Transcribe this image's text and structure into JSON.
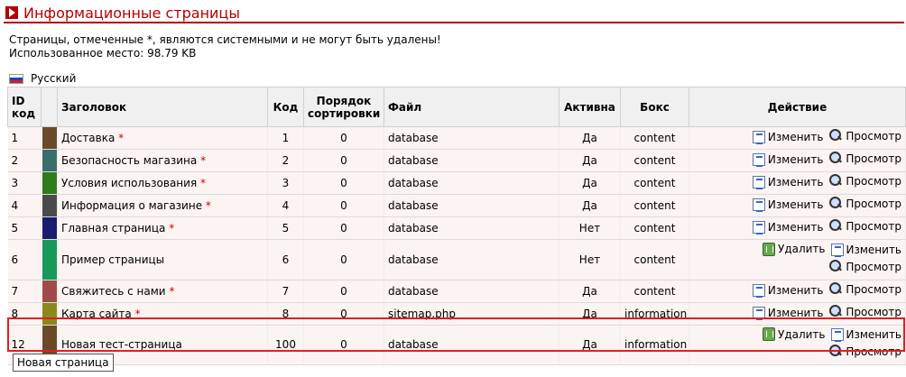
{
  "header": {
    "title": "Информационные страницы"
  },
  "notes": {
    "line1": "Страницы, отмеченные *, являются системными и не могут быть удалены!",
    "line2": "Использованное место: 98.79 KB"
  },
  "language": {
    "label": "Русский"
  },
  "columns": {
    "id": "ID",
    "id2": "код",
    "title": "Заголовок",
    "code": "Код",
    "sort": "Порядок",
    "sort2": "сортировки",
    "file": "Файл",
    "active": "Активна",
    "box": "Бокс",
    "action": "Действие"
  },
  "actions": {
    "edit": "Изменить",
    "view": "Просмотр",
    "delete": "Удалить"
  },
  "colors": {
    "accent": "#b40000",
    "row_bg": "#fcf3f3"
  },
  "rows": [
    {
      "id": "1",
      "title": "Доставка",
      "star": "*",
      "code": "1",
      "sort": "0",
      "file": "database",
      "active": "Да",
      "box": "content",
      "color": "#6b4a2a"
    },
    {
      "id": "2",
      "title": "Безопасность магазина",
      "star": "*",
      "code": "2",
      "sort": "0",
      "file": "database",
      "active": "Да",
      "box": "content",
      "color": "#3a6e6a"
    },
    {
      "id": "3",
      "title": "Условия использования",
      "star": "*",
      "code": "3",
      "sort": "0",
      "file": "database",
      "active": "Да",
      "box": "content",
      "color": "#2e7d1a"
    },
    {
      "id": "4",
      "title": "Информация о магазине",
      "star": "*",
      "code": "4",
      "sort": "0",
      "file": "database",
      "active": "Да",
      "box": "content",
      "color": "#4a4a4a"
    },
    {
      "id": "5",
      "title": "Главная страница",
      "star": "*",
      "code": "5",
      "sort": "0",
      "file": "database",
      "active": "Нет",
      "box": "content",
      "color": "#1a1a6e"
    },
    {
      "id": "6",
      "title": "Пример страницы",
      "star": "",
      "code": "6",
      "sort": "0",
      "file": "database",
      "active": "Нет",
      "box": "content",
      "color": "#1a9a5a"
    },
    {
      "id": "7",
      "title": "Свяжитесь с нами",
      "star": "*",
      "code": "7",
      "sort": "0",
      "file": "database",
      "active": "Да",
      "box": "content",
      "color": "#a04a4a"
    },
    {
      "id": "8",
      "title": "Карта сайта",
      "star": "*",
      "code": "8",
      "sort": "0",
      "file": "sitemap.php",
      "active": "Да",
      "box": "information",
      "color": "#8a8a1a"
    },
    {
      "id": "12",
      "title": "Новая тест-страница",
      "star": "",
      "code": "100",
      "sort": "0",
      "file": "database",
      "active": "Да",
      "box": "information",
      "color": "#6b4a2a"
    }
  ],
  "tooltip": {
    "text": "Новая страница"
  }
}
